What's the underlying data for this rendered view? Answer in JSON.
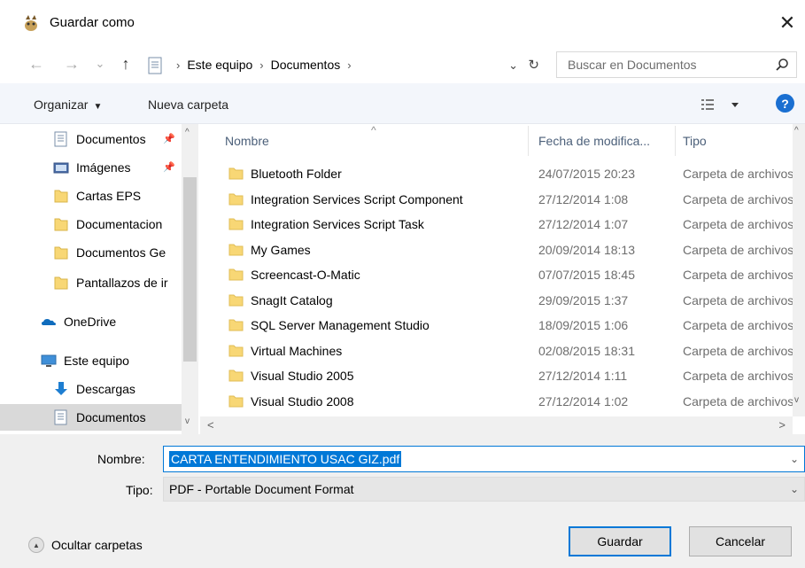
{
  "window": {
    "title": "Guardar como",
    "close_glyph": "✕"
  },
  "nav": {
    "back_glyph": "←",
    "forward_glyph": "→",
    "recent_glyph": "⌄",
    "up_glyph": "↑",
    "breadcrumbs": [
      "Este equipo",
      "Documentos"
    ],
    "crumb_separator": "›",
    "address_dropdown_glyph": "⌄",
    "refresh_glyph": "↻"
  },
  "search": {
    "placeholder": "Buscar en Documentos"
  },
  "toolbar": {
    "organize_label": "Organizar",
    "organize_caret": "▼",
    "new_folder_label": "Nueva carpeta",
    "help_label": "?"
  },
  "sidebar": {
    "items": [
      {
        "label": "Documentos",
        "icon": "document-folder-icon",
        "pinned": true
      },
      {
        "label": "Imágenes",
        "icon": "pictures-folder-icon",
        "pinned": true
      },
      {
        "label": "Cartas EPS",
        "icon": "folder-icon",
        "pinned": false
      },
      {
        "label": "Documentacion",
        "icon": "folder-icon",
        "pinned": false
      },
      {
        "label": "Documentos Ge",
        "icon": "folder-icon",
        "pinned": false
      },
      {
        "label": "Pantallazos de ir",
        "icon": "folder-icon",
        "pinned": false
      },
      {
        "label": "OneDrive",
        "icon": "onedrive-icon",
        "pinned": false
      },
      {
        "label": "Este equipo",
        "icon": "computer-icon",
        "pinned": false
      },
      {
        "label": "Descargas",
        "icon": "download-icon",
        "pinned": false
      },
      {
        "label": "Documentos",
        "icon": "document-folder-icon",
        "pinned": false,
        "selected": true
      }
    ],
    "pin_glyph": "📌",
    "scroll_up_glyph": "^",
    "scroll_down_glyph": "v"
  },
  "files": {
    "columns": {
      "name": "Nombre",
      "date": "Fecha de modifica...",
      "type": "Tipo"
    },
    "sort_glyph": "^",
    "rows": [
      {
        "name": "Bluetooth Folder",
        "date": "24/07/2015 20:23",
        "type": "Carpeta de archivos"
      },
      {
        "name": "Integration Services Script Component",
        "date": "27/12/2014 1:08",
        "type": "Carpeta de archivos"
      },
      {
        "name": "Integration Services Script Task",
        "date": "27/12/2014 1:07",
        "type": "Carpeta de archivos"
      },
      {
        "name": "My Games",
        "date": "20/09/2014 18:13",
        "type": "Carpeta de archivos"
      },
      {
        "name": "Screencast-O-Matic",
        "date": "07/07/2015 18:45",
        "type": "Carpeta de archivos"
      },
      {
        "name": "SnagIt Catalog",
        "date": "29/09/2015 1:37",
        "type": "Carpeta de archivos"
      },
      {
        "name": "SQL Server Management Studio",
        "date": "18/09/2015 1:06",
        "type": "Carpeta de archivos"
      },
      {
        "name": "Virtual Machines",
        "date": "02/08/2015 18:31",
        "type": "Carpeta de archivos"
      },
      {
        "name": "Visual Studio 2005",
        "date": "27/12/2014 1:11",
        "type": "Carpeta de archivos"
      },
      {
        "name": "Visual Studio 2008",
        "date": "27/12/2014 1:02",
        "type": "Carpeta de archivos"
      }
    ],
    "scroll_up_glyph": "^",
    "scroll_down_glyph": "v",
    "scroll_left_glyph": "<",
    "scroll_right_glyph": ">"
  },
  "save_form": {
    "name_label": "Nombre:",
    "name_value": "CARTA ENTENDIMIENTO USAC GIZ.pdf",
    "type_label": "Tipo:",
    "type_value": "PDF - Portable Document Format",
    "dropdown_glyph": "⌄"
  },
  "footer": {
    "hide_folders_label": "Ocultar carpetas",
    "hide_folders_glyph": "▲",
    "save_button": "Guardar",
    "cancel_button": "Cancelar"
  },
  "colors": {
    "accent": "#0078d7",
    "folder": "#f8d775",
    "toolbar_bg": "#f3f6fb",
    "footer_bg": "#f0f0f0",
    "selected_bg": "#d9d9d9"
  }
}
